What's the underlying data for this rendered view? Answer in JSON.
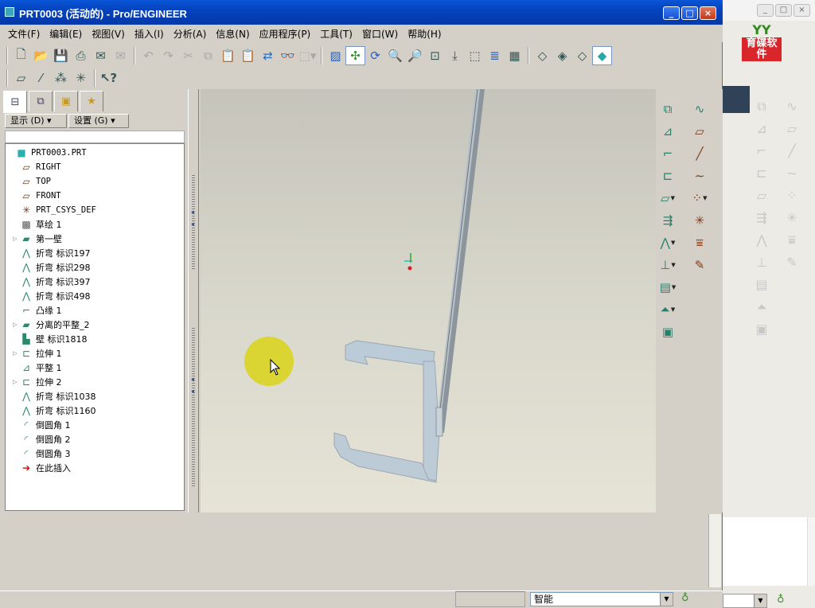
{
  "window": {
    "title": "PRT0003 (活动的) - Pro/ENGINEER",
    "controls": {
      "minimize": "_",
      "maximize": "□",
      "close": "×"
    }
  },
  "background_window": {
    "logo_text": "育碟软件",
    "logo_top": "YY"
  },
  "menu": [
    "文件(F)",
    "编辑(E)",
    "视图(V)",
    "插入(I)",
    "分析(A)",
    "信息(N)",
    "应用程序(P)",
    "工具(T)",
    "窗口(W)",
    "帮助(H)"
  ],
  "toolbar": {
    "icons": [
      "new-icon",
      "open-icon",
      "save-icon",
      "print-icon",
      "email-icon",
      "email-link-icon",
      "undo-icon",
      "redo-icon",
      "cut-icon",
      "copy-icon",
      "paste-icon",
      "paste-special-icon",
      "regenerate-icon",
      "find-icon",
      "select-box-icon",
      "repaint-icon",
      "spin-center-icon",
      "orient-icon",
      "zoom-in-icon",
      "zoom-out-icon",
      "refit-icon",
      "reorient-icon",
      "view-manager-icon",
      "layers-icon",
      "appearance-icon",
      "wireframe-icon",
      "hidden-line-icon",
      "no-hidden-icon",
      "shading-icon"
    ],
    "row2_icons": [
      "datum-plane-display-icon",
      "datum-axis-display-icon",
      "datum-point-display-icon",
      "csys-display-icon",
      "context-help-icon"
    ]
  },
  "model_tree": {
    "tabs": [
      "model-tree-tab",
      "layers-tab",
      "folder-browser-tab",
      "favorites-tab"
    ],
    "show_button": "显示 (D) ▾",
    "settings_button": "设置 (G) ▾",
    "items": [
      {
        "label": "PRT0003.PRT",
        "icon": "part-icon",
        "expand": false,
        "level": 0
      },
      {
        "label": "RIGHT",
        "icon": "datum-plane-icon",
        "expand": false,
        "level": 1
      },
      {
        "label": "TOP",
        "icon": "datum-plane-icon",
        "expand": false,
        "level": 1
      },
      {
        "label": "FRONT",
        "icon": "datum-plane-icon",
        "expand": false,
        "level": 1
      },
      {
        "label": "PRT_CSYS_DEF",
        "icon": "csys-icon",
        "expand": false,
        "level": 1
      },
      {
        "label": "草绘 1",
        "icon": "sketch-icon",
        "expand": false,
        "level": 1
      },
      {
        "label": "第一壁",
        "icon": "first-wall-icon",
        "expand": true,
        "level": 1
      },
      {
        "label": "折弯 标识197",
        "icon": "bend-icon",
        "expand": false,
        "level": 1
      },
      {
        "label": "折弯 标识298",
        "icon": "bend-icon",
        "expand": false,
        "level": 1
      },
      {
        "label": "折弯 标识397",
        "icon": "bend-icon",
        "expand": false,
        "level": 1
      },
      {
        "label": "折弯 标识498",
        "icon": "bend-icon",
        "expand": false,
        "level": 1
      },
      {
        "label": "凸缘 1",
        "icon": "flange-icon",
        "expand": false,
        "level": 1
      },
      {
        "label": "分离的平整_2",
        "icon": "unattached-flat-icon",
        "expand": true,
        "level": 1
      },
      {
        "label": "壁 标识1818",
        "icon": "wall-icon",
        "expand": false,
        "level": 1
      },
      {
        "label": "拉伸 1",
        "icon": "extrude-icon",
        "expand": true,
        "level": 1
      },
      {
        "label": "平整 1",
        "icon": "flat-icon",
        "expand": false,
        "level": 1
      },
      {
        "label": "拉伸 2",
        "icon": "extrude-icon",
        "expand": true,
        "level": 1
      },
      {
        "label": "折弯 标识1038",
        "icon": "bend-icon",
        "expand": false,
        "level": 1
      },
      {
        "label": "折弯 标识1160",
        "icon": "bend-icon",
        "expand": false,
        "level": 1
      },
      {
        "label": "倒圆角 1",
        "icon": "round-icon",
        "expand": false,
        "level": 1
      },
      {
        "label": "倒圆角 2",
        "icon": "round-icon",
        "expand": false,
        "level": 1
      },
      {
        "label": "倒圆角 3",
        "icon": "round-icon",
        "expand": false,
        "level": 1
      },
      {
        "label": "在此插入",
        "icon": "insert-here-arrow-icon",
        "expand": false,
        "level": 1
      }
    ]
  },
  "right_toolbar": {
    "icons": [
      "wall-tool-icon",
      "sketch-curve-icon",
      "flat-wall-icon",
      "datum-plane-tool-icon",
      "flange-tool-icon",
      "datum-axis-tool-icon",
      "unattached-wall-icon",
      "datum-curve-icon",
      "extrude-wall-icon",
      "datum-point-tool-icon",
      "rip-icon",
      "csys-tool-icon",
      "bend-tool-icon",
      "analysis-feature-icon",
      "unbend-tool-icon",
      "sketch-tool-icon",
      "flat-pattern-icon",
      "merge-tool-icon",
      "form-tool-icon",
      "convert-tool-icon"
    ]
  },
  "status": {
    "filter_value": "智能"
  },
  "colors": {
    "title_blue": "#0543bd",
    "model_face": "#b9c9d6",
    "model_edge": "#7f8a95",
    "cursor_highlight": "#e4e01a"
  }
}
